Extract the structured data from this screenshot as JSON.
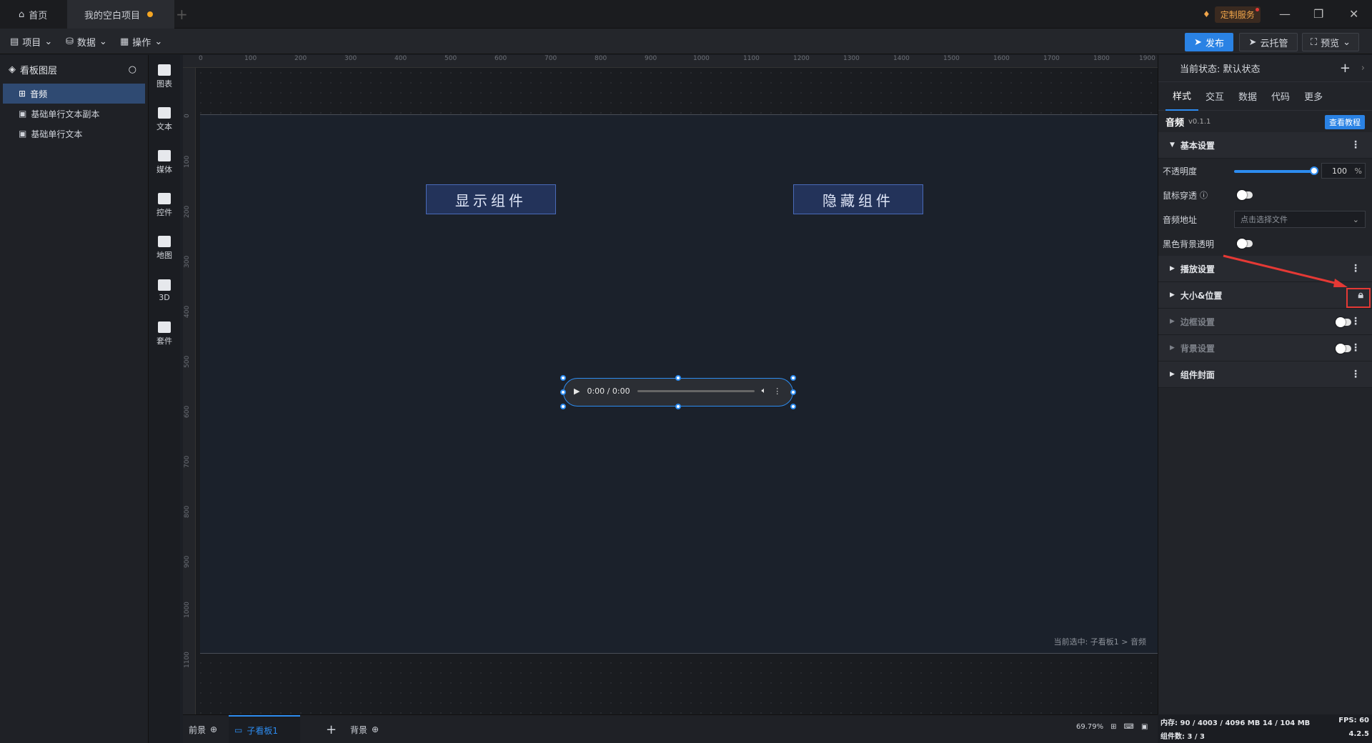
{
  "titlebar": {
    "home_tab": "首页",
    "project_tab": "我的空白项目",
    "custom_service": "定制服务"
  },
  "menubar": {
    "project": "项目",
    "data": "数据",
    "operate": "操作",
    "publish": "发布",
    "cloud_host": "云托管",
    "preview": "预览"
  },
  "layers": {
    "title": "看板图层",
    "items": [
      {
        "label": "音频",
        "active": true
      },
      {
        "label": "基础单行文本副本",
        "active": false
      },
      {
        "label": "基础单行文本",
        "active": false
      }
    ]
  },
  "components": [
    "图表",
    "文本",
    "媒体",
    "控件",
    "地图",
    "3D",
    "套件"
  ],
  "ruler": {
    "h_ticks": [
      "0",
      "100",
      "200",
      "300",
      "400",
      "500",
      "600",
      "700",
      "800",
      "900",
      "1000",
      "1100",
      "1200",
      "1300",
      "1400",
      "1500",
      "1600",
      "1700",
      "1800",
      "1900"
    ],
    "v_ticks": [
      "0",
      "100",
      "200",
      "300",
      "400",
      "500",
      "600",
      "700",
      "800",
      "900",
      "1000",
      "1100"
    ]
  },
  "canvas": {
    "show_button": "显示组件",
    "hide_button": "隐藏组件",
    "audio_time": "0:00 / 0:00",
    "selection_info": "当前选中: 子看板1 > 音频"
  },
  "bottombar": {
    "foreground": "前景",
    "sub_board": "子看板1",
    "background": "背景",
    "zoom": "69.79%"
  },
  "rpanel": {
    "state_label": "当前状态: 默认状态",
    "tabs": [
      "样式",
      "交互",
      "数据",
      "代码",
      "更多"
    ],
    "component_name": "音频",
    "component_version": "v0.1.1",
    "tutorial_button": "查看教程",
    "basic_settings": "基本设置",
    "opacity_label": "不透明度",
    "opacity_value": "100",
    "opacity_unit": "%",
    "mouse_through_label": "鼠标穿透",
    "audio_url_label": "音频地址",
    "audio_url_placeholder": "点击选择文件",
    "black_bg_label": "黑色背景透明",
    "play_settings": "播放设置",
    "size_position": "大小&位置",
    "border_settings": "边框设置",
    "bg_settings": "背景设置",
    "cover": "组件封面"
  },
  "status": {
    "memory": "内存: 90 / 4003 / 4096 MB 14 / 104 MB",
    "fps": "FPS: 60",
    "components": "组件数: 3 / 3",
    "version": "4.2.5"
  },
  "colors": {
    "accent": "#2d8cf0",
    "publish": "#2a82e4",
    "highlight": "#e53935"
  }
}
